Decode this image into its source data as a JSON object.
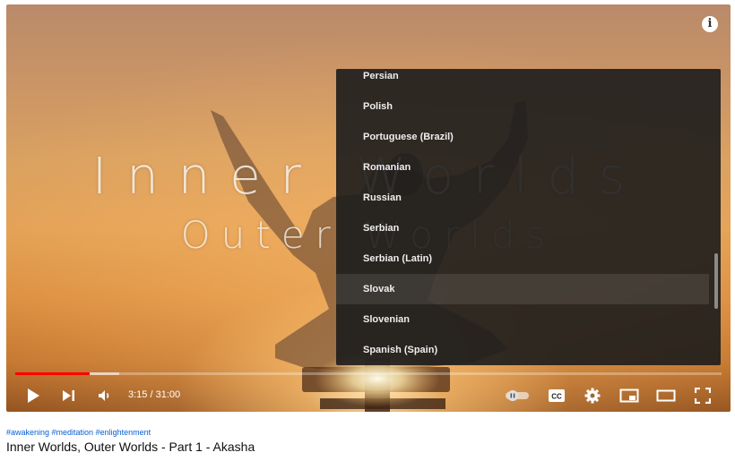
{
  "video": {
    "art_line1": "Inner Worlds",
    "art_line2": "Outer Worlds",
    "info_icon": "info-icon",
    "info_glyph": "i"
  },
  "subtitle_menu": {
    "items": [
      {
        "label": "Persian"
      },
      {
        "label": "Polish"
      },
      {
        "label": "Portuguese (Brazil)"
      },
      {
        "label": "Romanian"
      },
      {
        "label": "Russian"
      },
      {
        "label": "Serbian"
      },
      {
        "label": "Serbian (Latin)"
      },
      {
        "label": "Slovak"
      },
      {
        "label": "Slovenian"
      },
      {
        "label": "Spanish (Spain)"
      }
    ],
    "highlighted": "Slovak"
  },
  "progress": {
    "played_fraction": 0.1048,
    "buffered_fraction": 0.147,
    "played_color": "#ff0000"
  },
  "controls": {
    "time": "3:15 / 31:00",
    "play_icon": "play-icon",
    "next_icon": "next-icon",
    "volume_icon": "volume-icon",
    "autoplay_icon": "autoplay-toggle-icon",
    "cc_icon": "cc-icon",
    "cc_label": "CC",
    "settings_icon": "gear-icon",
    "miniplayer_icon": "miniplayer-icon",
    "theater_icon": "theater-icon",
    "fullscreen_icon": "fullscreen-icon"
  },
  "below": {
    "tags": "#awakening #meditation #enlightenment",
    "title": "Inner Worlds, Outer Worlds - Part 1 - Akasha"
  },
  "colors": {
    "hashtag": "#065fd4",
    "menu_bg": "#1c1c1c"
  }
}
